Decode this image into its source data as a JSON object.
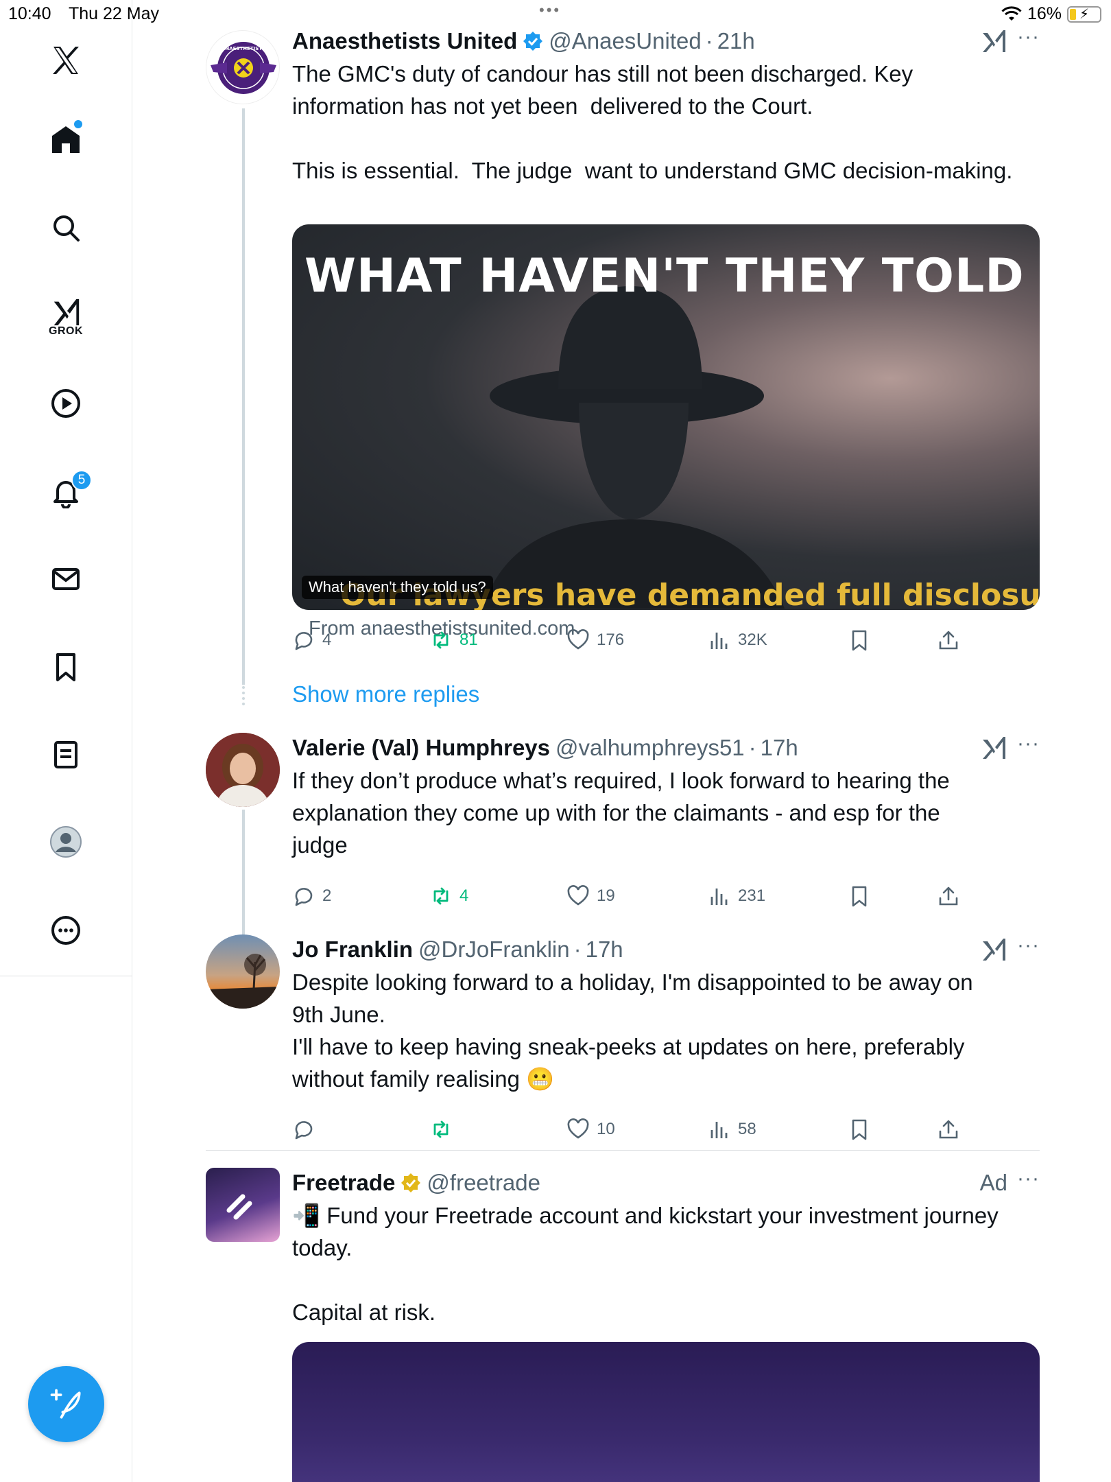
{
  "status_bar": {
    "time": "10:40",
    "date": "Thu 22 May",
    "battery": "16%"
  },
  "sidebar": {
    "grok_label": "GROK",
    "notifications_count": "5"
  },
  "tweets": [
    {
      "name": "Anaesthetists United",
      "handle": "@AnaesUnited",
      "time": "21h",
      "text": "The GMC's duty of candour has still not been discharged. Key\ninformation has not yet been  delivered to the Court.\n\nThis is essential.  The judge  want to understand GMC decision-making.",
      "media": {
        "headline": "WHAT HAVEN'T THEY TOLD US?",
        "subtitle": "Our lawyers have demanded full disclosure",
        "caption": "What haven't they told us?",
        "avatar_text": "ANAESTHETISTS UNITED"
      },
      "from": "From anaesthetistsunited.com",
      "replies": "4",
      "reposts": "81",
      "likes": "176",
      "views": "32K"
    },
    {
      "name": "Valerie (Val) Humphreys",
      "handle": "@valhumphreys51",
      "time": "17h",
      "text": "If they don’t produce what’s required, I look forward to hearing the\nexplanation they come up with for the claimants - and esp for the\njudge",
      "replies": "2",
      "reposts": "4",
      "likes": "19",
      "views": "231"
    },
    {
      "name": "Jo Franklin",
      "handle": "@DrJoFranklin",
      "time": "17h",
      "text": "Despite looking forward to a holiday, I'm disappointed to be away on\n9th June.\nI'll have to keep having sneak-peeks at updates on here, preferably\nwithout family realising 😬",
      "replies": "",
      "reposts": "",
      "likes": "10",
      "views": "58"
    },
    {
      "name": "Freetrade",
      "handle": "@freetrade",
      "ad_label": "Ad",
      "text": "📲 Fund your Freetrade account and kickstart your investment journey\ntoday.\n\nCapital at risk."
    }
  ],
  "show_more_replies": "Show more replies",
  "colors": {
    "accent": "#1d9bf0",
    "repost": "#00ba7c",
    "muted": "#536471",
    "gold_verified": "#e2b719"
  }
}
